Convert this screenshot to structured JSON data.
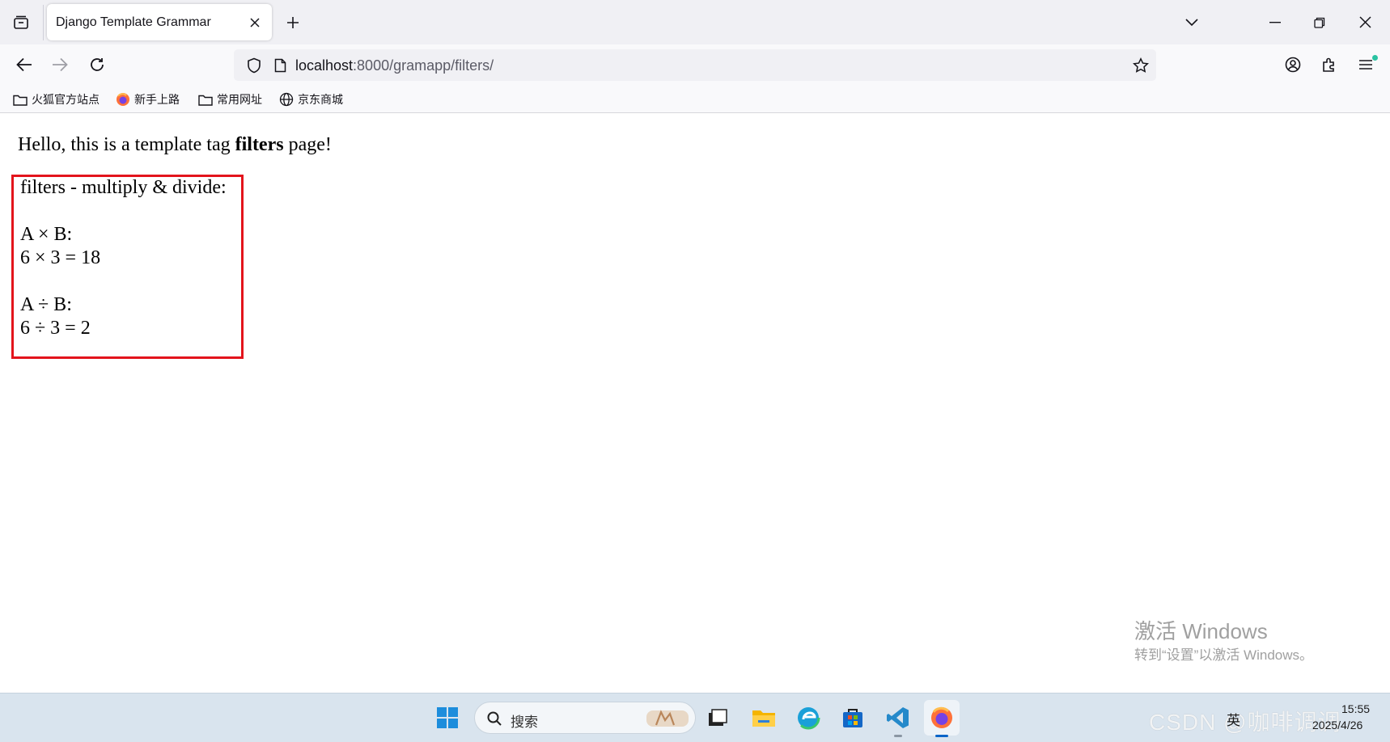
{
  "browser": {
    "tab": {
      "title": "Django Template Grammar"
    },
    "url": {
      "host": "localhost",
      "path": ":8000/gramapp/filters/"
    },
    "bookmarks": [
      {
        "label": "火狐官方站点",
        "icon": "folder-icon"
      },
      {
        "label": "新手上路",
        "icon": "firefox-icon"
      },
      {
        "label": "常用网址",
        "icon": "folder-icon"
      },
      {
        "label": "京东商城",
        "icon": "globe-icon"
      }
    ]
  },
  "page": {
    "intro_before": "Hello, this is a template tag ",
    "intro_bold": "filters",
    "intro_after": " page!",
    "box": {
      "heading": "filters - multiply & divide:",
      "multiply_label": "A × B:",
      "multiply_result": "6 × 3 = 18",
      "divide_label": "A ÷ B:",
      "divide_result": "6 ÷ 3 = 2"
    },
    "highlight_color": "#e3141c"
  },
  "watermark": {
    "title": "激活 Windows",
    "subtitle": "转到“设置”以激活 Windows。"
  },
  "taskbar": {
    "search_placeholder": "搜索",
    "tray_lang": "英",
    "overlay_text": "CSDN @咖啡调调",
    "time": "15:55",
    "date": "2025/4/26"
  }
}
